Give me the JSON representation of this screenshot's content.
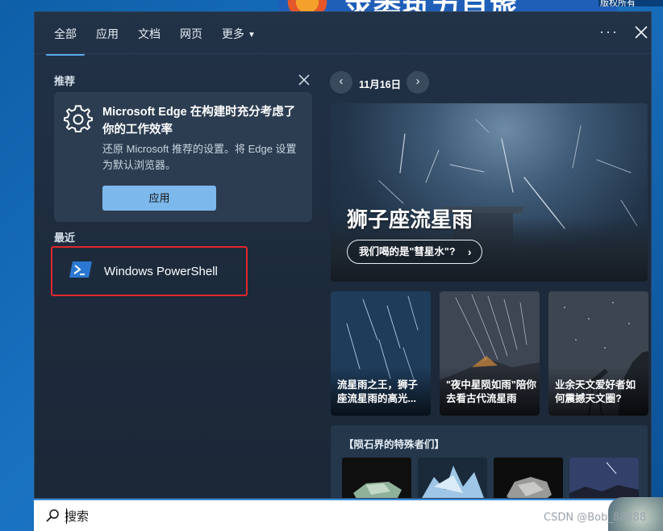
{
  "desktop": {
    "banner_text": "求委执力自旅",
    "corner_text": "版权所有"
  },
  "tabs": [
    {
      "label": "全部",
      "active": true
    },
    {
      "label": "应用",
      "active": false
    },
    {
      "label": "文档",
      "active": false
    },
    {
      "label": "网页",
      "active": false
    },
    {
      "label": "更多",
      "active": false
    }
  ],
  "toolbar": {
    "more_options_glyph": "···",
    "close_glyph": "✕"
  },
  "recommend": {
    "section_label": "推荐",
    "card_title": "Microsoft Edge 在构建时充分考虑了你的工作效率",
    "card_desc": "还原 Microsoft 推荐的设置。将 Edge 设置为默认浏览器。",
    "button_label": "应用"
  },
  "recent": {
    "section_label": "最近",
    "items": [
      {
        "label": "Windows PowerShell",
        "icon": "powershell-icon"
      }
    ]
  },
  "highlights": {
    "date": "11月16日",
    "prev_glyph": "‹",
    "next_glyph": "›",
    "hero_title": "狮子座流星雨",
    "hero_link": "我们喝的是\"彗星水\"?",
    "hero_link_arrow": "›",
    "thumbs": [
      {
        "text": "流星雨之王，狮子座流星雨的高光..."
      },
      {
        "text": "\"夜中星陨如雨\"陪你去看古代流星雨"
      },
      {
        "text": "业余天文爱好者如何震撼天文圈?"
      }
    ],
    "meteor_section_title": "【陨石界的特殊者们】"
  },
  "search": {
    "placeholder": "搜索"
  },
  "watermark": "CSDN @Bob_88888",
  "colors": {
    "accent": "#5aa8e8",
    "highlight_border": "#e0282e",
    "apply_button": "#7cb8ec",
    "panel_bg": "#1f2e40"
  }
}
